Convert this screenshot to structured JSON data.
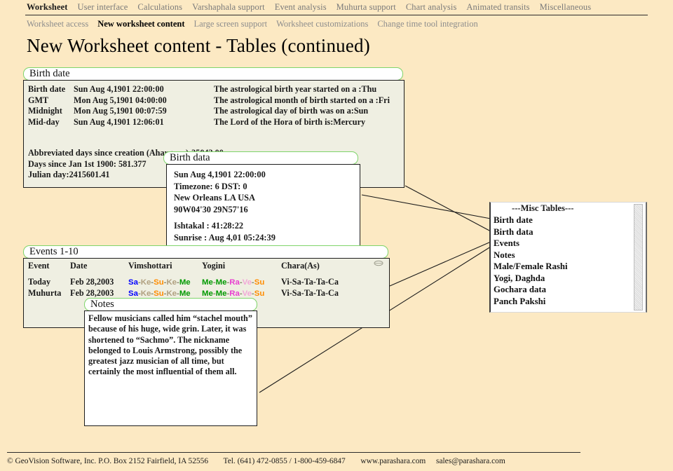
{
  "nav": {
    "primary": [
      {
        "label": "Worksheet",
        "active": true
      },
      {
        "label": "User interface",
        "active": false
      },
      {
        "label": "Calculations",
        "active": false
      },
      {
        "label": "Varshaphala support",
        "active": false
      },
      {
        "label": "Event analysis",
        "active": false
      },
      {
        "label": "Muhurta support",
        "active": false
      },
      {
        "label": "Chart analysis",
        "active": false
      },
      {
        "label": "Animated transits",
        "active": false
      },
      {
        "label": "Miscellaneous",
        "active": false
      }
    ],
    "secondary": [
      {
        "label": "Worksheet access",
        "active": false
      },
      {
        "label": "New worksheet content",
        "active": true
      },
      {
        "label": "Large screen support",
        "active": false
      },
      {
        "label": "Worksheet customizations",
        "active": false
      },
      {
        "label": "Change time tool integration",
        "active": false
      }
    ]
  },
  "page": {
    "title": "New Worksheet content - Tables (continued)"
  },
  "birth_date_panel": {
    "title": "Birth date",
    "rows": [
      {
        "label": "Birth date",
        "value": "Sun Aug 4,1901   22:00:00",
        "note": "The astrological birth year started on a :Thu"
      },
      {
        "label": "GMT",
        "value": "Mon Aug 5,1901   04:00:00",
        "note": "The astrological month of birth started on a :Fri"
      },
      {
        "label": "Midnight",
        "value": "Mon Aug 5,1901   00:07:59",
        "note": "The astrological day of birth was on a:Sun"
      },
      {
        "label": "Mid-day",
        "value": "Sun Aug 4,1901   12:06:01",
        "note": "The Lord of the Hora of birth is:Mercury"
      }
    ],
    "extra": [
      "Abbreviated days since creation (Ahargana):35043.00",
      "Days since Jan 1st 1900: 581.377",
      "Julian day:2415601.41"
    ]
  },
  "birth_data_panel": {
    "title": "Birth data",
    "lines": [
      "Sun Aug 4,1901   22:00:00",
      "Timezone: 6   DST: 0",
      "New Orleans LA USA",
      "90W04'30   29N57'16",
      "",
      "Ishtakal : 41:28:22",
      "Sunrise : Aug 4,01  05:24:39"
    ]
  },
  "events_panel": {
    "title": "Events 1-10",
    "columns": [
      "Event",
      "Date",
      "Vimshottari",
      "Yogini",
      "Chara(As)"
    ],
    "rows": [
      {
        "event": "Today",
        "date": "Feb 28,2003",
        "vimshottari": [
          {
            "text": "Sa",
            "color": "#0000FF"
          },
          {
            "text": "Ke",
            "color": "#B0A080"
          },
          {
            "text": "Su",
            "color": "#FF8C00"
          },
          {
            "text": "Ke",
            "color": "#B0A080"
          },
          {
            "text": "Me",
            "color": "#009900"
          }
        ],
        "yogini": [
          {
            "text": "Me",
            "color": "#009900"
          },
          {
            "text": "Me",
            "color": "#009900"
          },
          {
            "text": "Ra",
            "color": "#E83FD0"
          },
          {
            "text": "Ve",
            "color": "#F2A8D8"
          },
          {
            "text": "Su",
            "color": "#FF8C00"
          }
        ],
        "chara": "Vi-Sa-Ta-Ta-Ca"
      },
      {
        "event": "Muhurta",
        "date": "Feb 28,2003",
        "vimshottari": [
          {
            "text": "Sa",
            "color": "#0000FF"
          },
          {
            "text": "Ke",
            "color": "#B0A080"
          },
          {
            "text": "Su",
            "color": "#FF8C00"
          },
          {
            "text": "Ke",
            "color": "#B0A080"
          },
          {
            "text": "Me",
            "color": "#009900"
          }
        ],
        "yogini": [
          {
            "text": "Me",
            "color": "#009900"
          },
          {
            "text": "Me",
            "color": "#009900"
          },
          {
            "text": "Ra",
            "color": "#E83FD0"
          },
          {
            "text": "Ve",
            "color": "#F2A8D8"
          },
          {
            "text": "Su",
            "color": "#FF8C00"
          }
        ],
        "chara": "Vi-Sa-Ta-Ta-Ca"
      }
    ]
  },
  "notes_panel": {
    "title": "Notes",
    "text": "Fellow musicians called him “stachel mouth” because of his huge, wide grin. Later, it was shortened to “Sachmo”. The nickname belonged to Louis Armstrong, possibly the greatest jazz musician of all time, but certainly the most influential of them all."
  },
  "misc_tables": {
    "header": "---Misc Tables---",
    "items": [
      "Birth date",
      "Birth data",
      "Events",
      "Notes",
      "Male/Female Rashi",
      "Yogi, Daghda",
      "Gochara data",
      "Panch Pakshi"
    ]
  },
  "footer": {
    "company": "© GeoVision Software, Inc. P.O. Box 2152 Fairfield, IA 52556",
    "phone": "Tel. (641) 472-0855 / 1-800-459-6847",
    "website": "www.parashara.com",
    "email": "sales@parashara.com"
  },
  "colors": {
    "page_background": "#FCE9C3",
    "panel_border_green": "#7FD46A",
    "panel_body": "#EFEFE2",
    "text": "#1a1a1a",
    "nav_inactive": "#7a7a7a"
  }
}
